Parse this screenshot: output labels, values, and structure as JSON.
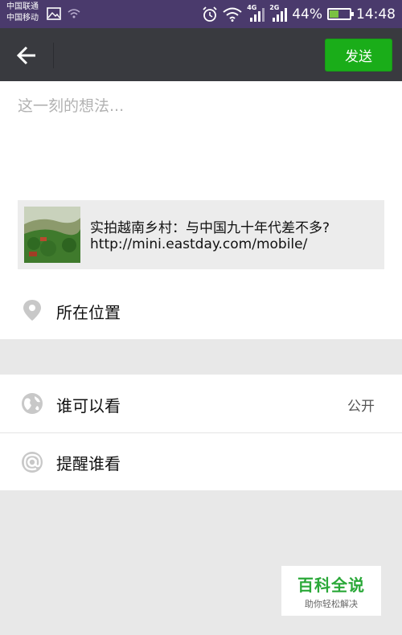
{
  "status_bar": {
    "carrier1": "中国联通",
    "carrier2": "中国移动",
    "net1": "4G",
    "net2": "2G",
    "battery": "44%",
    "battery_level": 0.44,
    "time": "14:48"
  },
  "action_bar": {
    "send_label": "发送",
    "accent_color": "#1aad19"
  },
  "compose": {
    "placeholder": "这一刻的想法..."
  },
  "link_card": {
    "title": "实拍越南乡村：与中国九十年代差不多?",
    "url": "http://mini.eastday.com/mobile/"
  },
  "options": {
    "location_label": "所在位置",
    "privacy_label": "谁可以看",
    "privacy_value": "公开",
    "mention_label": "提醒谁看"
  },
  "watermark": {
    "title": "百科全说",
    "subtitle": "助你轻松解决"
  }
}
